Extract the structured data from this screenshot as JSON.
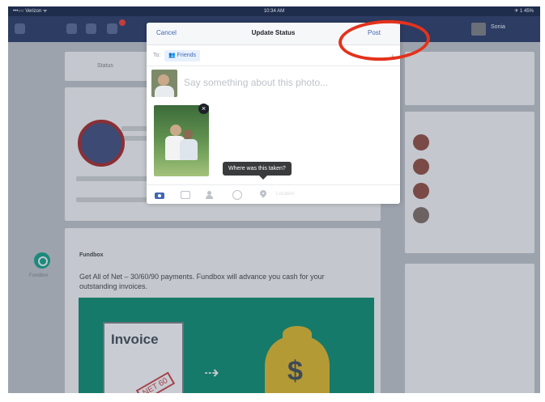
{
  "status_bar": {
    "carrier": "•••○○ Verizon ᯤ",
    "time": "10:34 AM",
    "battery": "✈ 1 45%"
  },
  "nav": {
    "user_name": "Sonia"
  },
  "background": {
    "feed_tab": "Status",
    "sponsor_name": "Fundbox",
    "ad_text": "Get All of Net – 30/60/90 payments. Fundbox will advance you cash for your outstanding invoices.",
    "invoice_text": "Invoice",
    "stamp_text": "NET 60",
    "dollar_sign": "$",
    "side_logo_label": "Fundbox"
  },
  "dialog": {
    "cancel_label": "Cancel",
    "title": "Update Status",
    "post_label": "Post",
    "to_label": "To:",
    "audience": "Friends",
    "status_placeholder": "Say something about this photo...",
    "tooltip": "Where was this taken?",
    "location_placeholder": "Location",
    "remove_glyph": "×"
  },
  "colors": {
    "accent": "#4267b2",
    "annotation": "#e3321c",
    "nav": "#2c3c63"
  }
}
